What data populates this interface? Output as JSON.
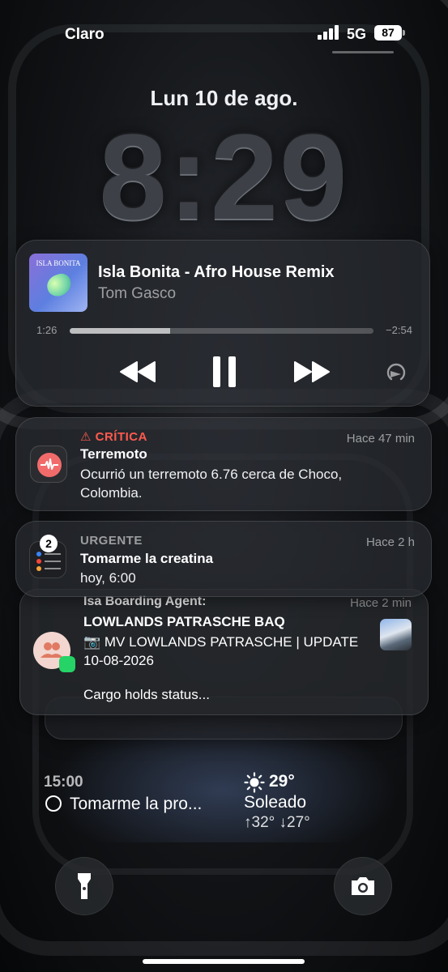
{
  "status_bar": {
    "carrier": "Claro",
    "network": "5G",
    "battery": "87"
  },
  "lock": {
    "date": "Lun 10 de ago.",
    "time": "8:29"
  },
  "now_playing": {
    "art_text": "ISLA BONITA",
    "title": "Isla Bonita - Afro House Remix",
    "artist": "Tom Gasco",
    "elapsed": "1:26",
    "remaining": "−2:54",
    "progress": 0.33
  },
  "notifications": [
    {
      "app": "earthquake-alert",
      "level": "CRÍTICA",
      "time": "Hace 47 min",
      "title": "Terremoto",
      "body": "Ocurrió un terremoto 6.76 cerca de Choco, Colombia."
    },
    {
      "app": "reminders",
      "level": "URGENTE",
      "count": "2",
      "time": "Hace 2 h",
      "title": "Tomarme la creatina",
      "body": "hoy, 6:00"
    },
    {
      "app": "whatsapp",
      "sender": "Isa Boarding Agent:",
      "time": "Hace 2 min",
      "title": "LOWLANDS PATRASCHE BAQ",
      "body": "📷 MV LOWLANDS PATRASCHE | UPDATE 10-08-2026",
      "preview": "Cargo holds status..."
    }
  ],
  "widgets": {
    "reminder_time": "15:00",
    "reminder_task": "Tomarme la pro...",
    "weather_temp": "29°",
    "weather_condition": "Soleado",
    "weather_range": "↑32° ↓27°"
  },
  "colors": {
    "critical": "#ff5a4e",
    "whatsapp": "#25d366"
  }
}
